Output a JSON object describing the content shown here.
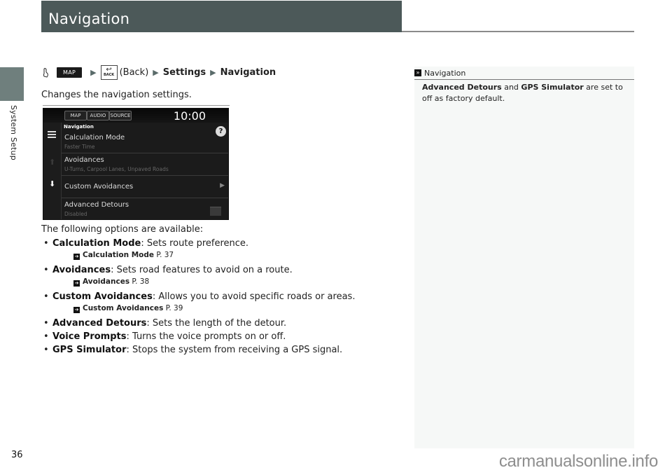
{
  "header": {
    "title": "Navigation",
    "accent_color": "#4c5959"
  },
  "side_tab": {
    "label": "System Setup"
  },
  "breadcrumb": {
    "home_icon": "home-hand-icon",
    "map_button": "MAP",
    "back_button": {
      "arrow": "↩",
      "text": "BACK"
    },
    "back_label": "(Back)",
    "step1": "Settings",
    "step2": "Navigation"
  },
  "intro": "Changes the navigation settings.",
  "device": {
    "tabs": [
      "MAP",
      "AUDIO",
      "SOURCE"
    ],
    "clock": "10:00",
    "list_heading": "Navigation",
    "help": "?",
    "rows": [
      {
        "title": "Calculation Mode",
        "subtitle": "Faster Time"
      },
      {
        "title": "Avoidances",
        "subtitle": "U-Turns, Carpool Lanes, Unpaved Roads"
      },
      {
        "title": "Custom Avoidances",
        "subtitle": ""
      },
      {
        "title": "Advanced Detours",
        "subtitle": "Disabled"
      }
    ]
  },
  "options": {
    "intro": "The following options are available:",
    "items": [
      {
        "term": "Calculation Mode",
        "desc": ": Sets route preference.",
        "ref": {
          "term": "Calculation Mode",
          "page": " P. 37"
        }
      },
      {
        "term": "Avoidances",
        "desc": ": Sets road features to avoid on a route.",
        "ref": {
          "term": "Avoidances",
          "page": " P. 38"
        }
      },
      {
        "term": "Custom Avoidances",
        "desc": ": Allows you to avoid specific roads or areas.",
        "ref": {
          "term": "Custom Avoidances",
          "page": " P. 39"
        }
      },
      {
        "term": "Advanced Detours",
        "desc": ": Sets the length of the detour."
      },
      {
        "term": "Voice Prompts",
        "desc": ": Turns the voice prompts on or off."
      },
      {
        "term": "GPS Simulator",
        "desc": ": Stops the system from receiving a GPS signal."
      }
    ]
  },
  "note": {
    "heading": "Navigation",
    "term1": "Advanced Detours",
    "mid": " and ",
    "term2": "GPS Simulator",
    "rest": " are set to off as factory default."
  },
  "footer": {
    "page_number": "36",
    "watermark": "carmanualsonline.info"
  }
}
